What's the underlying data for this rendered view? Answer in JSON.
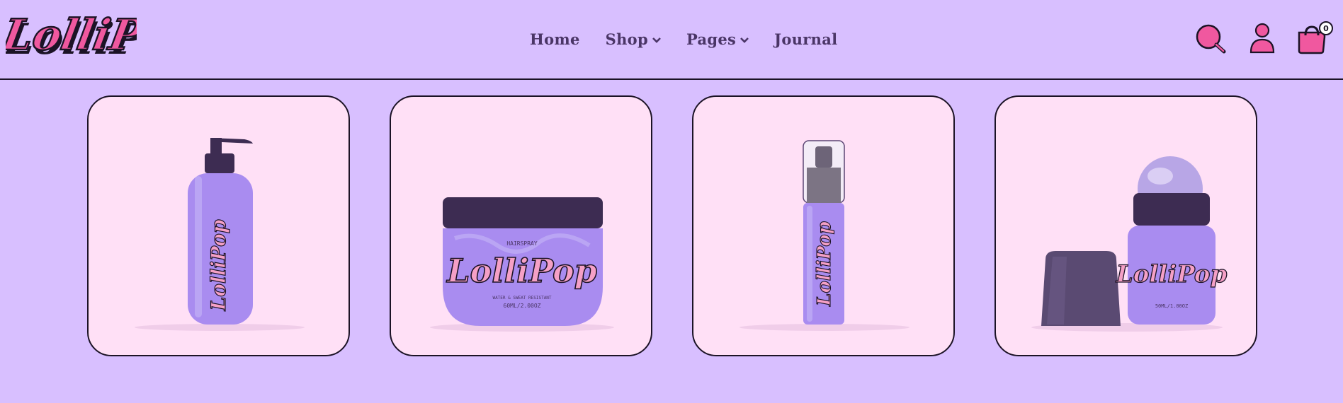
{
  "brand": {
    "name": "LolliPop"
  },
  "nav": {
    "items": [
      {
        "label": "Home",
        "has_dropdown": false
      },
      {
        "label": "Shop",
        "has_dropdown": true
      },
      {
        "label": "Pages",
        "has_dropdown": true
      },
      {
        "label": "Journal",
        "has_dropdown": false
      }
    ]
  },
  "header_icons": {
    "search": "search-icon",
    "account": "user-icon",
    "cart": "shopping-bag-icon",
    "cart_count": "0"
  },
  "colors": {
    "background": "#d8bfff",
    "card": "#ffe0f6",
    "accent_pink": "#f0589f",
    "text_purple": "#4a3566",
    "product_purple": "#a98cf0",
    "cap_dark": "#3d2c52"
  },
  "products": [
    {
      "type": "pump-bottle",
      "brand_label": "LolliPop"
    },
    {
      "type": "jar",
      "brand_label": "LolliPop",
      "line": "HAIRSPRAY",
      "sub": "WATER & SWEAT RESISTANT",
      "volume": "60ML/2.00OZ"
    },
    {
      "type": "spray-bottle",
      "brand_label": "LolliPop"
    },
    {
      "type": "roll-on",
      "brand_label": "LolliPop",
      "volume": "50ML/1.00OZ"
    }
  ]
}
